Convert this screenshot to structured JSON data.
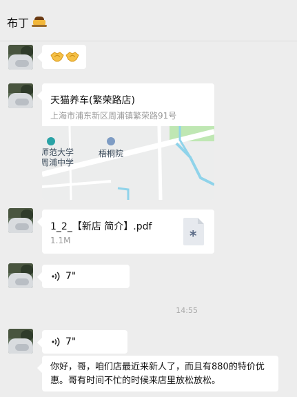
{
  "header": {
    "title": "布丁",
    "emoji": "pudding-emoji"
  },
  "messages": [
    {
      "type": "emoji",
      "content": "🤝🤝",
      "icon": "handshake-icon"
    },
    {
      "type": "location",
      "name": "天猫养车(繁荣路店)",
      "address": "上海市浦东新区周浦镇繁荣路91号",
      "map_labels": {
        "school_line1": "师范大学",
        "school_line2": "周浦中学",
        "poi": "梧桐院"
      }
    },
    {
      "type": "file",
      "name": "1_2_【新店 简介】.pdf",
      "size": "1.1M",
      "icon": "file-icon"
    },
    {
      "type": "voice",
      "duration": "7\""
    },
    {
      "type": "timestamp",
      "text": "14:55"
    },
    {
      "type": "voice",
      "duration": "7\""
    },
    {
      "type": "text",
      "content": "你好，哥，咱们店最近来新人了，而且有880的特价优惠。哥有时间不忙的时候来店里放松放松。"
    }
  ],
  "colors": {
    "background": "#ededed",
    "bubble": "#ffffff",
    "secondary_text": "#9a9a9a"
  }
}
